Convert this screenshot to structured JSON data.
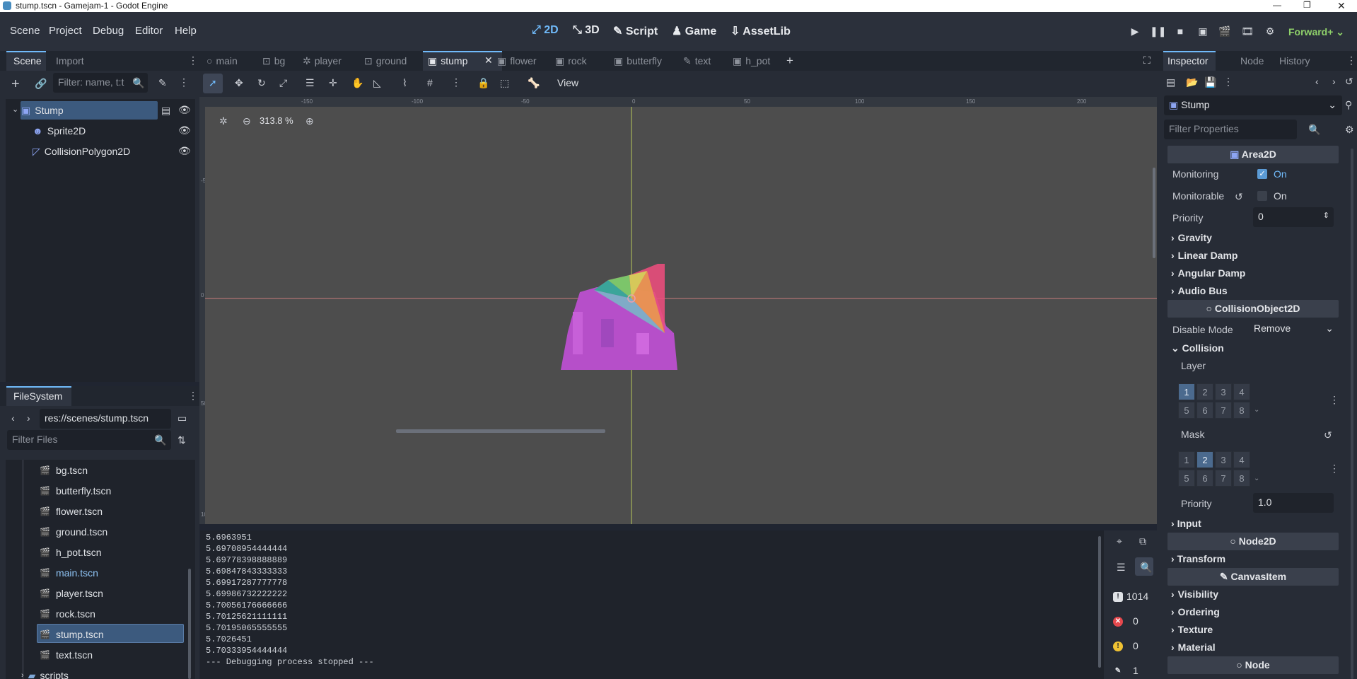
{
  "window": {
    "title": "stump.tscn - Gamejam-1 - Godot Engine"
  },
  "menu": [
    "Scene",
    "Project",
    "Debug",
    "Editor",
    "Help"
  ],
  "workspaces": [
    {
      "label": "2D",
      "icon": "2d-icon",
      "active": true
    },
    {
      "label": "3D",
      "icon": "3d-icon",
      "active": false
    },
    {
      "label": "Script",
      "icon": "script-icon",
      "active": false
    },
    {
      "label": "Game",
      "icon": "game-icon",
      "active": false
    },
    {
      "label": "AssetLib",
      "icon": "assetlib-icon",
      "active": false
    }
  ],
  "renderer": "Forward+",
  "scene_dock": {
    "tabs": [
      "Scene",
      "Import"
    ],
    "filter_placeholder": "Filter: name, t:t",
    "nodes": [
      {
        "name": "Stump",
        "icon": "area2d-icon",
        "selected": true
      },
      {
        "name": "Sprite2D",
        "icon": "sprite2d-icon"
      },
      {
        "name": "CollisionPolygon2D",
        "icon": "collision-polygon-icon"
      }
    ]
  },
  "scene_tabs": [
    {
      "label": "main",
      "icon": "node-icon"
    },
    {
      "label": "bg",
      "icon": "control-icon"
    },
    {
      "label": "player",
      "icon": "body-icon"
    },
    {
      "label": "ground",
      "icon": "static-body-icon"
    },
    {
      "label": "stump",
      "icon": "area2d-icon",
      "active": true
    },
    {
      "label": "flower",
      "icon": "area2d-icon"
    },
    {
      "label": "rock",
      "icon": "area2d-icon"
    },
    {
      "label": "butterfly",
      "icon": "area2d-icon"
    },
    {
      "label": "text",
      "icon": "label-icon"
    },
    {
      "label": "h_pot",
      "icon": "area2d-icon"
    }
  ],
  "canvas_toolbar": {
    "view_label": "View"
  },
  "viewport": {
    "zoom": "313.8 %",
    "ruler_h": [
      "-150",
      "-100",
      "-50",
      "0",
      "50",
      "100",
      "150",
      "200"
    ],
    "ruler_v": [
      "-50",
      "0",
      "50",
      "100"
    ]
  },
  "filesystem": {
    "tab": "FileSystem",
    "path": "res://scenes/stump.tscn",
    "filter_placeholder": "Filter Files",
    "files": [
      {
        "name": "bg.tscn"
      },
      {
        "name": "butterfly.tscn"
      },
      {
        "name": "flower.tscn"
      },
      {
        "name": "ground.tscn"
      },
      {
        "name": "h_pot.tscn"
      },
      {
        "name": "main.tscn",
        "highlight": true
      },
      {
        "name": "player.tscn"
      },
      {
        "name": "rock.tscn"
      },
      {
        "name": "stump.tscn",
        "selected": true
      },
      {
        "name": "text.tscn"
      }
    ],
    "folder": "scripts"
  },
  "output": {
    "lines": [
      "5.6963951",
      "5.69708954444444",
      "5.69778398888889",
      "5.69847843333333",
      "5.69917287777778",
      "5.69986732222222",
      "5.70056176666666",
      "5.70125621111111",
      "5.70195065555555",
      "5.7026451",
      "5.70333954444444",
      "--- Debugging process stopped ---"
    ],
    "counts": {
      "messages": "1014",
      "errors": "0",
      "warnings": "0",
      "other": "1"
    }
  },
  "inspector": {
    "tabs": [
      "Inspector",
      "Node",
      "History"
    ],
    "object": "Stump",
    "filter_placeholder": "Filter Properties",
    "sections": {
      "area2d": "Area2D",
      "collision_object": "CollisionObject2D",
      "node2d": "Node2D",
      "canvas_item": "CanvasItem",
      "node": "Node"
    },
    "monitoring": {
      "label": "Monitoring",
      "value": "On",
      "checked": true
    },
    "monitorable": {
      "label": "Monitorable",
      "value": "On",
      "checked": false
    },
    "priority": {
      "label": "Priority",
      "value": "0"
    },
    "categories_area": [
      "Gravity",
      "Linear Damp",
      "Angular Damp",
      "Audio Bus"
    ],
    "disable_mode": {
      "label": "Disable Mode",
      "value": "Remove"
    },
    "collision": {
      "label": "Collision",
      "layer_label": "Layer",
      "mask_label": "Mask",
      "bits": [
        "1",
        "2",
        "3",
        "4",
        "5",
        "6",
        "7",
        "8"
      ],
      "layer_on": [
        1
      ],
      "mask_on": [
        2
      ],
      "priority_label": "Priority",
      "priority_value": "1.0"
    },
    "input": "Input",
    "transform": "Transform",
    "canvas_categories": [
      "Visibility",
      "Ordering",
      "Texture",
      "Material"
    ]
  },
  "colors": {
    "accent": "#70bafa",
    "renderer": "#8fd16a",
    "selection": "#3c5a7e",
    "area2d_icon": "#8da5f3"
  }
}
